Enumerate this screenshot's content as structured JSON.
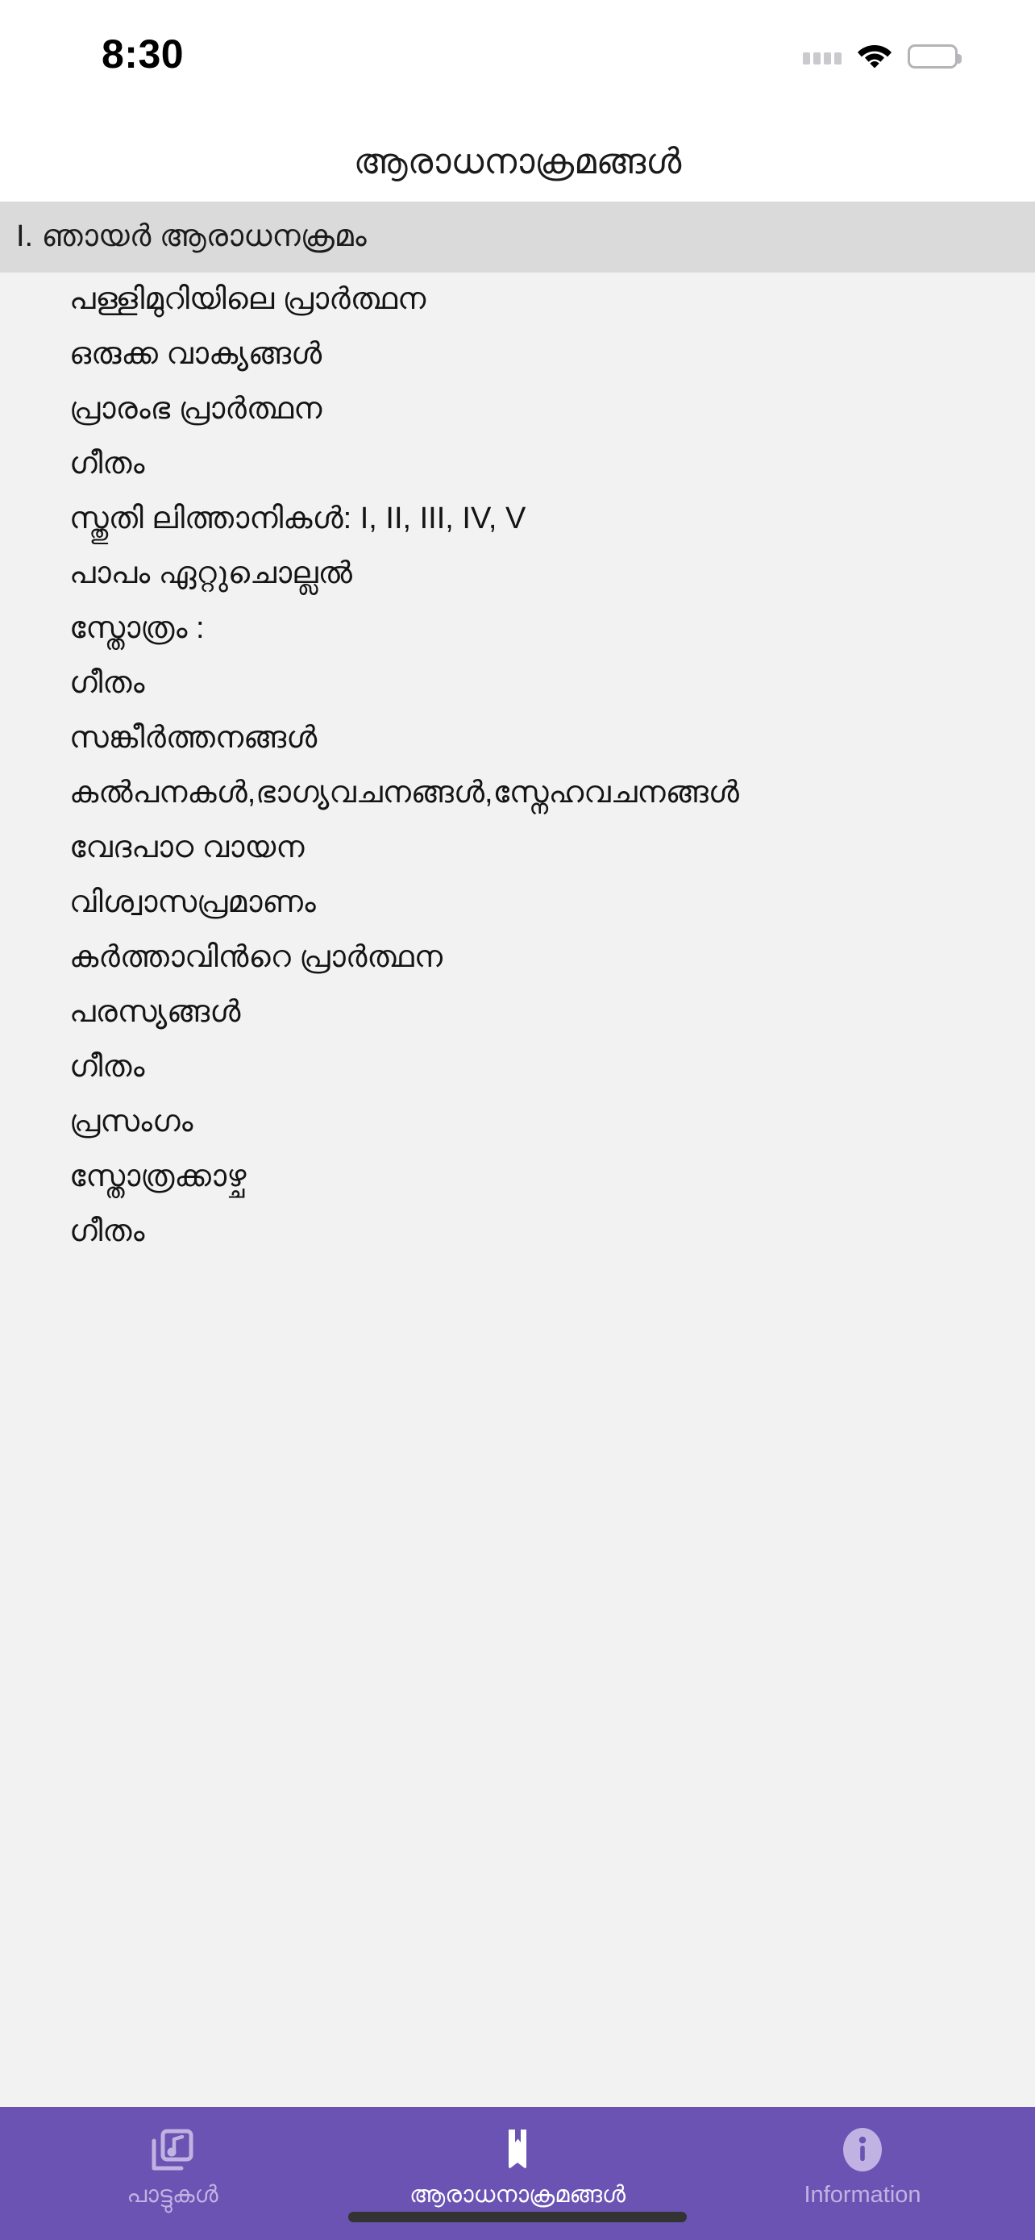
{
  "status_bar": {
    "time": "8:30",
    "signal_icon": "cellular-signal-dots",
    "wifi_icon": "wifi-icon",
    "battery_icon": "battery-full-icon"
  },
  "nav": {
    "title": "ആരാധനാക്രമങ്ങൾ"
  },
  "section": {
    "header": "I. ഞായർ ആരാധനക്രമം"
  },
  "items": [
    {
      "label": "പള്ളിമുറിയിലെ പ്രാർത്ഥന"
    },
    {
      "label": "ഒരുക്ക വാക്യങ്ങൾ"
    },
    {
      "label": "പ്രാരംഭ പ്രാർത്ഥന"
    },
    {
      "label": "ഗീതം"
    },
    {
      "label": "സ്തുതി ലിത്താനികൾ: I, II, III, IV, V"
    },
    {
      "label": "പാപം ഏറ്റുചൊല്ലൽ"
    },
    {
      "label": "സ്തോത്രം :"
    },
    {
      "label": "ഗീതം"
    },
    {
      "label": "സങ്കീർത്തനങ്ങൾ"
    },
    {
      "label": "കൽപനകൾ,ഭാഗ്യവചനങ്ങൾ,സ്നേഹവചനങ്ങൾ"
    },
    {
      "label": "വേദപാഠ വായന"
    },
    {
      "label": "വിശ്വാസപ്രമാണം"
    },
    {
      "label": "കർത്താവിൻറെ പ്രാർത്ഥന"
    },
    {
      "label": "പരസ്യങ്ങൾ"
    },
    {
      "label": "ഗീതം"
    },
    {
      "label": "പ്രസംഗം"
    },
    {
      "label": "സ്തോത്രക്കാഴ്ച"
    },
    {
      "label": "ഗീതം"
    }
  ],
  "tab_bar": {
    "background_color": "#6A53B2",
    "active_color": "#FFFFFF",
    "inactive_color": "#C0B2E2",
    "tabs": [
      {
        "label": "പാട്ടുകൾ",
        "icon": "music-library-icon",
        "active": false
      },
      {
        "label": "ആരാധനാക്രമങ്ങൾ",
        "icon": "bookmark-book-icon",
        "active": true
      },
      {
        "label": "Information",
        "icon": "info-circle-icon",
        "active": false
      }
    ]
  }
}
